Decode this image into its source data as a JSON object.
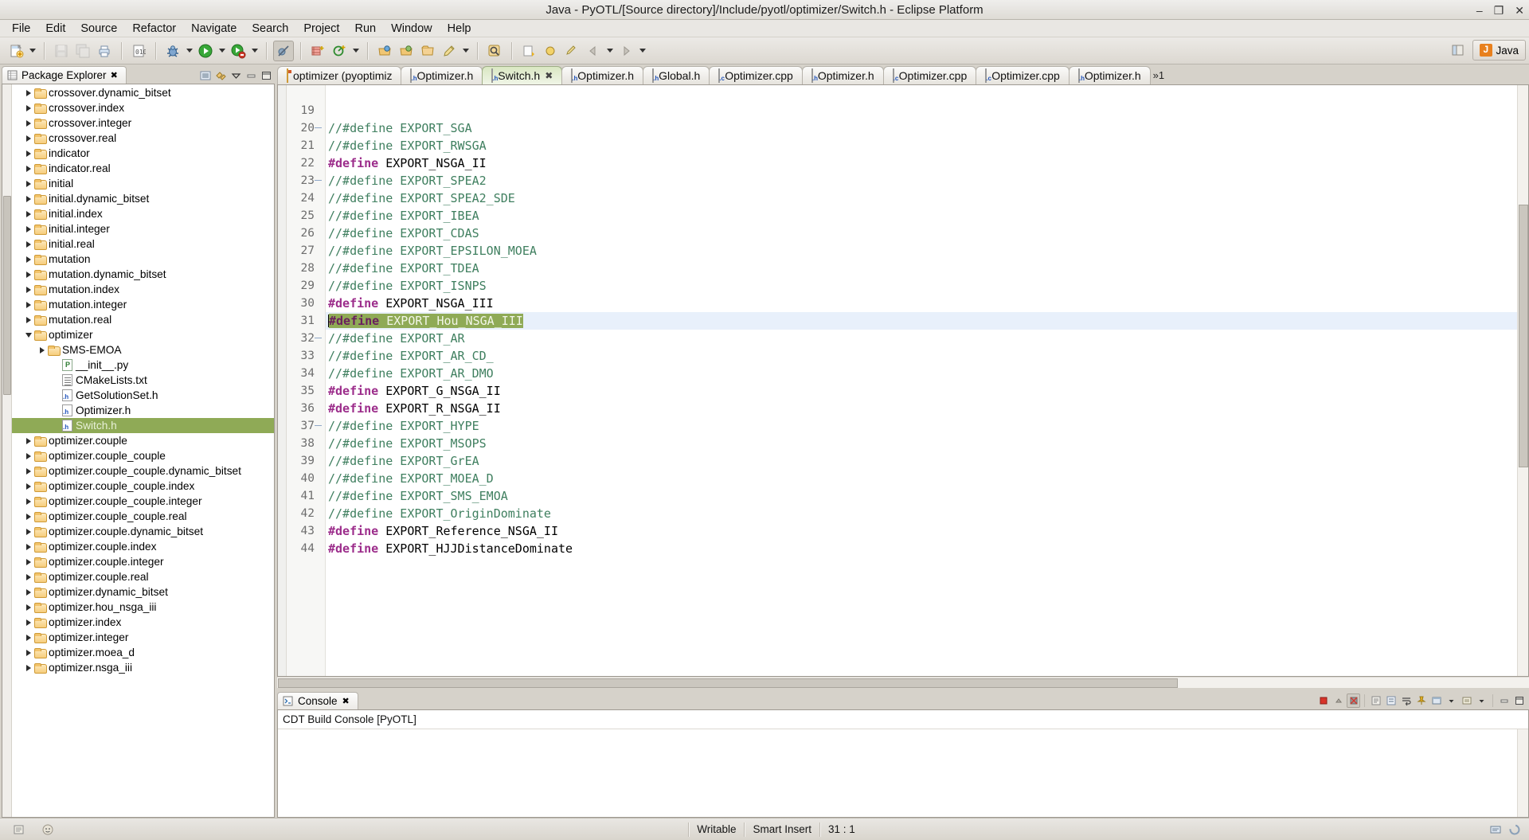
{
  "window": {
    "title": "Java - PyOTL/[Source directory]/Include/pyotl/optimizer/Switch.h - Eclipse Platform",
    "minimize": "–",
    "maximize": "❐",
    "close": "✕"
  },
  "menu": {
    "items": [
      "File",
      "Edit",
      "Source",
      "Refactor",
      "Navigate",
      "Search",
      "Project",
      "Run",
      "Window",
      "Help"
    ]
  },
  "toolbar": {
    "perspective_label": "Java",
    "groups": [
      {
        "buttons": [
          "new-wizard-icon",
          "new-dropdown-arrow"
        ]
      },
      {
        "buttons": [
          "save-icon",
          "save-all-icon",
          "print-icon"
        ]
      },
      {
        "buttons": [
          "build-all-icon"
        ]
      },
      {
        "buttons": [
          "debug-icon",
          "debug-dropdown-arrow",
          "run-icon",
          "run-dropdown-arrow",
          "external-tools-icon",
          "external-tools-dropdown-arrow"
        ]
      },
      {
        "buttons": [
          "skip-breakpoints-icon"
        ]
      },
      {
        "buttons": [
          "new-class-icon",
          "new-package-icon",
          "new-java-dropdown-arrow"
        ]
      },
      {
        "buttons": [
          "open-type-icon",
          "open-task-icon",
          "open-resource-icon",
          "annotation-icon",
          "annotation-dropdown-arrow"
        ]
      },
      {
        "buttons": [
          "search-icon"
        ]
      },
      {
        "buttons": [
          "next-annotation-icon",
          "prev-annotation-icon",
          "last-edit-icon",
          "back-icon",
          "forward-icon"
        ]
      }
    ]
  },
  "sidebar": {
    "view_title": "Package Explorer",
    "view_close": "✖",
    "tools": [
      "collapse-all-icon",
      "link-with-editor-icon",
      "view-menu-icon",
      "minimize-icon",
      "maximize-icon"
    ],
    "tree": [
      {
        "label": "crossover.dynamic_bitset",
        "icon": "folder",
        "indent": 2,
        "expand": "collapsed"
      },
      {
        "label": "crossover.index",
        "icon": "folder",
        "indent": 2,
        "expand": "collapsed"
      },
      {
        "label": "crossover.integer",
        "icon": "folder",
        "indent": 2,
        "expand": "collapsed"
      },
      {
        "label": "crossover.real",
        "icon": "folder",
        "indent": 2,
        "expand": "collapsed"
      },
      {
        "label": "indicator",
        "icon": "folder",
        "indent": 2,
        "expand": "collapsed"
      },
      {
        "label": "indicator.real",
        "icon": "folder",
        "indent": 2,
        "expand": "collapsed"
      },
      {
        "label": "initial",
        "icon": "folder",
        "indent": 2,
        "expand": "collapsed"
      },
      {
        "label": "initial.dynamic_bitset",
        "icon": "folder",
        "indent": 2,
        "expand": "collapsed"
      },
      {
        "label": "initial.index",
        "icon": "folder",
        "indent": 2,
        "expand": "collapsed"
      },
      {
        "label": "initial.integer",
        "icon": "folder",
        "indent": 2,
        "expand": "collapsed"
      },
      {
        "label": "initial.real",
        "icon": "folder",
        "indent": 2,
        "expand": "collapsed"
      },
      {
        "label": "mutation",
        "icon": "folder",
        "indent": 2,
        "expand": "collapsed"
      },
      {
        "label": "mutation.dynamic_bitset",
        "icon": "folder",
        "indent": 2,
        "expand": "collapsed"
      },
      {
        "label": "mutation.index",
        "icon": "folder",
        "indent": 2,
        "expand": "collapsed"
      },
      {
        "label": "mutation.integer",
        "icon": "folder",
        "indent": 2,
        "expand": "collapsed"
      },
      {
        "label": "mutation.real",
        "icon": "folder",
        "indent": 2,
        "expand": "collapsed"
      },
      {
        "label": "optimizer",
        "icon": "folder",
        "indent": 2,
        "expand": "expanded"
      },
      {
        "label": "SMS-EMOA",
        "icon": "folder",
        "indent": 3,
        "expand": "collapsed"
      },
      {
        "label": "__init__.py",
        "icon": "py",
        "indent": 4,
        "expand": "none"
      },
      {
        "label": "CMakeLists.txt",
        "icon": "txt",
        "indent": 4,
        "expand": "none"
      },
      {
        "label": "GetSolutionSet.h",
        "icon": "h",
        "indent": 4,
        "expand": "none"
      },
      {
        "label": "Optimizer.h",
        "icon": "h",
        "indent": 4,
        "expand": "none"
      },
      {
        "label": "Switch.h",
        "icon": "h",
        "indent": 4,
        "expand": "none",
        "selected": true
      },
      {
        "label": "optimizer.couple",
        "icon": "folder",
        "indent": 2,
        "expand": "collapsed"
      },
      {
        "label": "optimizer.couple_couple",
        "icon": "folder",
        "indent": 2,
        "expand": "collapsed"
      },
      {
        "label": "optimizer.couple_couple.dynamic_bitset",
        "icon": "folder",
        "indent": 2,
        "expand": "collapsed"
      },
      {
        "label": "optimizer.couple_couple.index",
        "icon": "folder",
        "indent": 2,
        "expand": "collapsed"
      },
      {
        "label": "optimizer.couple_couple.integer",
        "icon": "folder",
        "indent": 2,
        "expand": "collapsed"
      },
      {
        "label": "optimizer.couple_couple.real",
        "icon": "folder",
        "indent": 2,
        "expand": "collapsed"
      },
      {
        "label": "optimizer.couple.dynamic_bitset",
        "icon": "folder",
        "indent": 2,
        "expand": "collapsed"
      },
      {
        "label": "optimizer.couple.index",
        "icon": "folder",
        "indent": 2,
        "expand": "collapsed"
      },
      {
        "label": "optimizer.couple.integer",
        "icon": "folder",
        "indent": 2,
        "expand": "collapsed"
      },
      {
        "label": "optimizer.couple.real",
        "icon": "folder",
        "indent": 2,
        "expand": "collapsed"
      },
      {
        "label": "optimizer.dynamic_bitset",
        "icon": "folder",
        "indent": 2,
        "expand": "collapsed"
      },
      {
        "label": "optimizer.hou_nsga_iii",
        "icon": "folder",
        "indent": 2,
        "expand": "collapsed"
      },
      {
        "label": "optimizer.index",
        "icon": "folder",
        "indent": 2,
        "expand": "collapsed"
      },
      {
        "label": "optimizer.integer",
        "icon": "folder",
        "indent": 2,
        "expand": "collapsed"
      },
      {
        "label": "optimizer.moea_d",
        "icon": "folder",
        "indent": 2,
        "expand": "collapsed"
      },
      {
        "label": "optimizer.nsga_iii",
        "icon": "folder",
        "indent": 2,
        "expand": "collapsed"
      }
    ]
  },
  "editor": {
    "tabs": [
      {
        "label": "optimizer (pyoptimiz",
        "icon": "pkg",
        "active": false
      },
      {
        "label": "Optimizer.h",
        "icon": "h",
        "active": false
      },
      {
        "label": "Switch.h",
        "icon": "h",
        "active": true,
        "close": "✖"
      },
      {
        "label": "Optimizer.h",
        "icon": "h",
        "active": false
      },
      {
        "label": "Global.h",
        "icon": "h",
        "active": false
      },
      {
        "label": "Optimizer.cpp",
        "icon": "c",
        "active": false
      },
      {
        "label": "Optimizer.h",
        "icon": "h",
        "active": false
      },
      {
        "label": "Optimizer.cpp",
        "icon": "c",
        "active": false
      },
      {
        "label": "Optimizer.cpp",
        "icon": "c",
        "active": false
      },
      {
        "label": "Optimizer.h",
        "icon": "h",
        "active": false
      }
    ],
    "overflow": "»1",
    "lines": [
      {
        "num": 19,
        "fold": false,
        "kw": "",
        "rest": ""
      },
      {
        "num": 20,
        "fold": true,
        "kw": "",
        "rest": "//#define EXPORT_SGA",
        "comment": true
      },
      {
        "num": 21,
        "fold": false,
        "kw": "",
        "rest": "//#define EXPORT_RWSGA",
        "comment": true
      },
      {
        "num": 22,
        "fold": false,
        "kw": "#define",
        "rest": " EXPORT_NSGA_II",
        "comment": false
      },
      {
        "num": 23,
        "fold": true,
        "kw": "",
        "rest": "//#define EXPORT_SPEA2",
        "comment": true
      },
      {
        "num": 24,
        "fold": false,
        "kw": "",
        "rest": "//#define EXPORT_SPEA2_SDE",
        "comment": true
      },
      {
        "num": 25,
        "fold": false,
        "kw": "",
        "rest": "//#define EXPORT_IBEA",
        "comment": true
      },
      {
        "num": 26,
        "fold": false,
        "kw": "",
        "rest": "//#define EXPORT_CDAS",
        "comment": true
      },
      {
        "num": 27,
        "fold": false,
        "kw": "",
        "rest": "//#define EXPORT_EPSILON_MOEA",
        "comment": true
      },
      {
        "num": 28,
        "fold": false,
        "kw": "",
        "rest": "//#define EXPORT_TDEA",
        "comment": true
      },
      {
        "num": 29,
        "fold": false,
        "kw": "",
        "rest": "//#define EXPORT_ISNPS",
        "comment": true
      },
      {
        "num": 30,
        "fold": false,
        "kw": "#define",
        "rest": " EXPORT_NSGA_III",
        "comment": false
      },
      {
        "num": 31,
        "fold": false,
        "kw": "#define",
        "rest": " EXPORT_Hou_NSGA_III",
        "comment": false,
        "current": true,
        "selected": true
      },
      {
        "num": 32,
        "fold": true,
        "kw": "",
        "rest": "//#define EXPORT_AR",
        "comment": true
      },
      {
        "num": 33,
        "fold": false,
        "kw": "",
        "rest": "//#define EXPORT_AR_CD_",
        "comment": true
      },
      {
        "num": 34,
        "fold": false,
        "kw": "",
        "rest": "//#define EXPORT_AR_DMO",
        "comment": true
      },
      {
        "num": 35,
        "fold": false,
        "kw": "#define",
        "rest": " EXPORT_G_NSGA_II",
        "comment": false
      },
      {
        "num": 36,
        "fold": false,
        "kw": "#define",
        "rest": " EXPORT_R_NSGA_II",
        "comment": false
      },
      {
        "num": 37,
        "fold": true,
        "kw": "",
        "rest": "//#define EXPORT_HYPE",
        "comment": true
      },
      {
        "num": 38,
        "fold": false,
        "kw": "",
        "rest": "//#define EXPORT_MSOPS",
        "comment": true
      },
      {
        "num": 39,
        "fold": false,
        "kw": "",
        "rest": "//#define EXPORT_GrEA",
        "comment": true
      },
      {
        "num": 40,
        "fold": false,
        "kw": "",
        "rest": "//#define EXPORT_MOEA_D",
        "comment": true
      },
      {
        "num": 41,
        "fold": false,
        "kw": "",
        "rest": "//#define EXPORT_SMS_EMOA",
        "comment": true
      },
      {
        "num": 42,
        "fold": false,
        "kw": "",
        "rest": "//#define EXPORT_OriginDominate",
        "comment": true
      },
      {
        "num": 43,
        "fold": false,
        "kw": "#define",
        "rest": " EXPORT_Reference_NSGA_II",
        "comment": false
      },
      {
        "num": 44,
        "fold": false,
        "kw": "#define",
        "rest": " EXPORT_HJJDistanceDominate",
        "comment": false
      }
    ]
  },
  "console": {
    "tab_label": "Console",
    "tab_close": "✖",
    "header": "CDT Build Console [PyOTL]",
    "content": "",
    "tools": [
      "terminate-icon",
      "remove-launch-icon",
      "remove-all-icon",
      "clear-console-icon",
      "scroll-lock-icon",
      "pin-console-icon",
      "word-wrap-icon",
      "display-console-icon",
      "display-console-arrow",
      "open-console-icon",
      "open-console-arrow",
      "minimize-icon",
      "maximize-icon"
    ]
  },
  "statusbar": {
    "writable": "Writable",
    "insert_mode": "Smart Insert",
    "position": "31 : 1"
  }
}
